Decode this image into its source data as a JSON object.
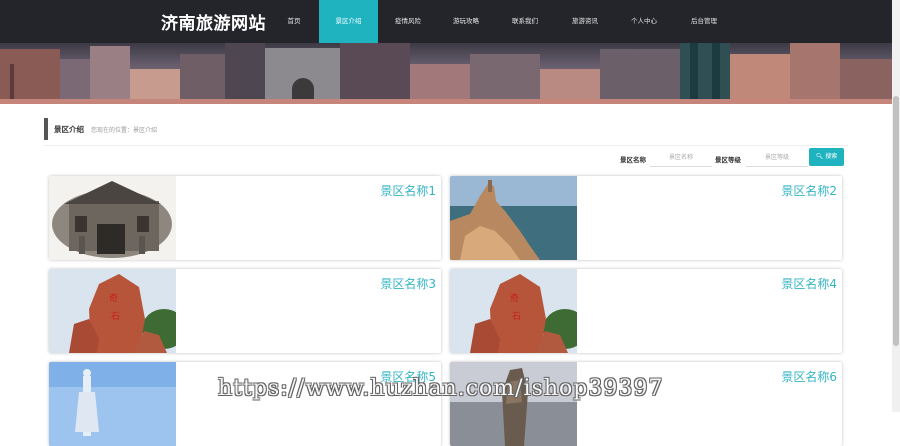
{
  "brand": "济南旅游网站",
  "nav": [
    "首页",
    "景区介绍",
    "疫情风险",
    "游玩攻略",
    "联系我们",
    "旅游资讯",
    "个人中心",
    "后台管理"
  ],
  "nav_active_index": 1,
  "breadcrumb": {
    "title": "景区介绍",
    "location": "您现在的位置：景区介绍"
  },
  "search": {
    "name_label": "景区名称",
    "name_placeholder": "景区名称",
    "level_label": "景区等级",
    "level_placeholder": "景区等级",
    "button_label": "搜索"
  },
  "cards": [
    {
      "name": "景区名称1",
      "image": "archway-icon"
    },
    {
      "name": "景区名称2",
      "image": "sea-cliff-icon"
    },
    {
      "name": "景区名称3",
      "image": "red-rock-icon"
    },
    {
      "name": "景区名称4",
      "image": "red-rock-icon"
    },
    {
      "name": "景区名称5",
      "image": "statue-icon"
    },
    {
      "name": "景区名称6",
      "image": "rock-pillar-icon"
    }
  ],
  "watermark": "https://www.huzhan.com/ishop39397",
  "colors": {
    "accent": "#1fb3c0",
    "topbar": "#24252a",
    "card_title": "#33b5c4"
  }
}
